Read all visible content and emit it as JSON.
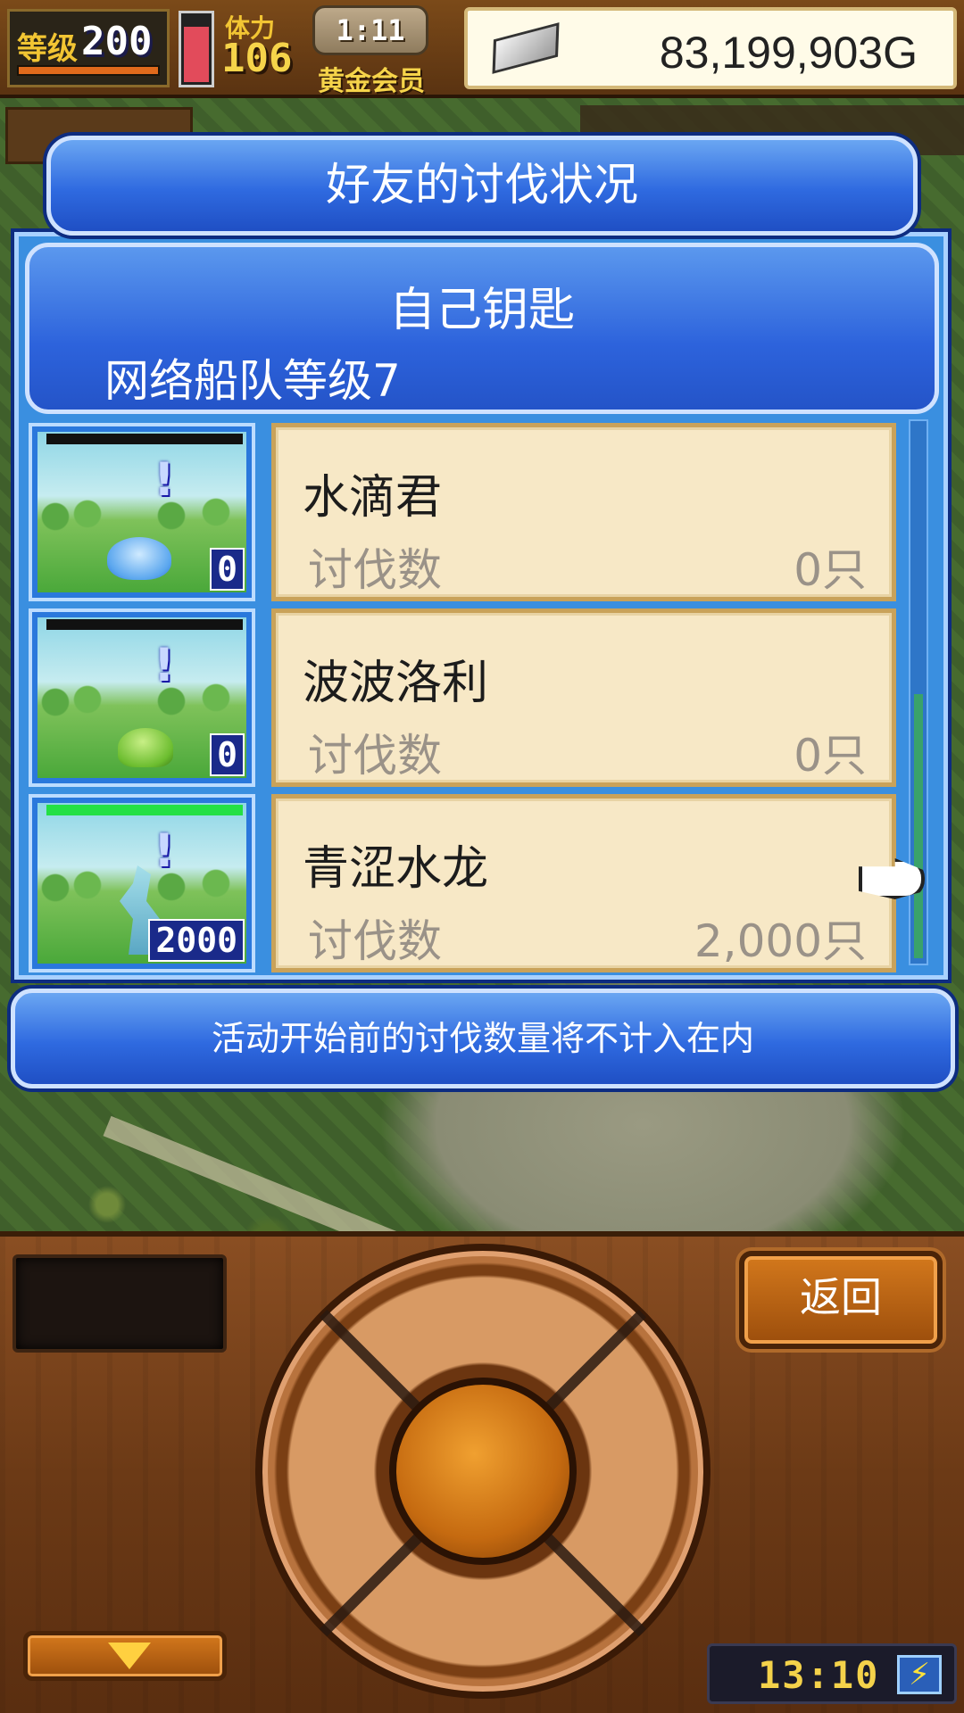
{
  "hud": {
    "level_label": "等级",
    "level_value": "200",
    "stamina_label": "体力",
    "stamina_value": "106",
    "timer": "1:11",
    "member": "黄金会员",
    "gold": "83,199,903G"
  },
  "dialog": {
    "title": "好友的讨伐状况",
    "key_title": "自己钥匙",
    "fleet_level": "网络船队等级7",
    "notice": "活动开始前的讨伐数量将不计入在内"
  },
  "monsters": [
    {
      "name": "水滴君",
      "kill_label": "讨伐数",
      "kill_value": "0只",
      "badge": "0",
      "sprite": "drop-icon",
      "hp_state": "empty"
    },
    {
      "name": "波波洛利",
      "kill_label": "讨伐数",
      "kill_value": "0只",
      "badge": "0",
      "sprite": "slime-icon",
      "hp_state": "empty"
    },
    {
      "name": "青涩水龙",
      "kill_label": "讨伐数",
      "kill_value": "2,000只",
      "badge": "2000",
      "sprite": "dragon-icon",
      "hp_state": "full"
    }
  ],
  "controls": {
    "back_label": "返回",
    "clock": "13:10",
    "battery_icon": "charging-bolt-icon"
  },
  "colors": {
    "panel_blue": "#2f6ae0",
    "card_cream": "#f7e8c6",
    "gold_text": "#f6d44a",
    "hp_full": "#24e044"
  }
}
